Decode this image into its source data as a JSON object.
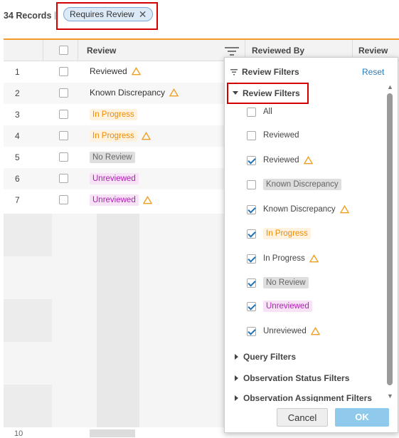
{
  "header": {
    "records_label": "34 Records",
    "separator": "|",
    "active_filter_chip": "Requires Review"
  },
  "table": {
    "columns": [
      "Review",
      "Reviewed By",
      "Review Re"
    ],
    "rows": [
      {
        "num": "1",
        "review": "Reviewed",
        "style": "plain",
        "warn": true
      },
      {
        "num": "2",
        "review": "Known Discrepancy",
        "style": "plain",
        "warn": true
      },
      {
        "num": "3",
        "review": "In Progress",
        "style": "inprog",
        "warn": false
      },
      {
        "num": "4",
        "review": "In Progress",
        "style": "inprog",
        "warn": true
      },
      {
        "num": "5",
        "review": "No Review",
        "style": "noreview",
        "warn": false
      },
      {
        "num": "6",
        "review": "Unreviewed",
        "style": "unrev",
        "warn": false
      },
      {
        "num": "7",
        "review": "Unreviewed",
        "style": "unrev",
        "warn": true
      }
    ],
    "partial_row_number": "10"
  },
  "filter_panel": {
    "title": "Review Filters",
    "reset_label": "Reset",
    "section_title": "Review Filters",
    "items": [
      {
        "label": "All",
        "checked": false,
        "style": "plain",
        "warn": false
      },
      {
        "label": "Reviewed",
        "checked": false,
        "style": "plain",
        "warn": false
      },
      {
        "label": "Reviewed",
        "checked": true,
        "style": "plain",
        "warn": true
      },
      {
        "label": "Known Discrepancy",
        "checked": false,
        "style": "noreview",
        "warn": false
      },
      {
        "label": "Known Discrepancy",
        "checked": true,
        "style": "plain",
        "warn": true
      },
      {
        "label": "In Progress",
        "checked": true,
        "style": "inprog",
        "warn": false
      },
      {
        "label": "In Progress",
        "checked": true,
        "style": "plain",
        "warn": true
      },
      {
        "label": "No Review",
        "checked": true,
        "style": "noreview",
        "warn": false
      },
      {
        "label": "Unreviewed",
        "checked": true,
        "style": "unrev",
        "warn": false
      },
      {
        "label": "Unreviewed",
        "checked": true,
        "style": "plain",
        "warn": true
      }
    ],
    "collapsed_sections": [
      "Query Filters",
      "Observation Status Filters",
      "Observation Assignment Filters"
    ],
    "cancel_label": "Cancel",
    "ok_label": "OK"
  },
  "colors": {
    "accent": "#f39a2b",
    "highlight_box": "#d40000",
    "link": "#2a7ab8",
    "ok_button": "#8fc9ec",
    "in_progress": "#f08a00",
    "unreviewed": "#b21cb8"
  }
}
